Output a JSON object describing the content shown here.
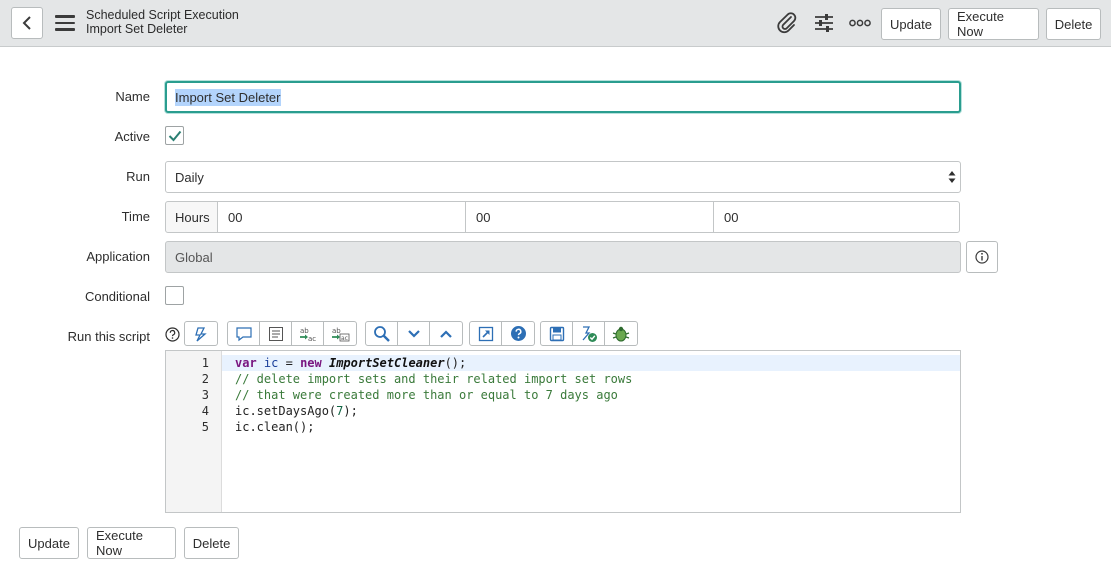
{
  "header": {
    "record_type": "Scheduled Script Execution",
    "record_name": "Import Set Deleter",
    "update_label": "Update",
    "execute_label": "Execute Now",
    "delete_label": "Delete"
  },
  "form": {
    "name_label": "Name",
    "name_value": "Import Set Deleter",
    "active_label": "Active",
    "active_checked": true,
    "run_label": "Run",
    "run_value": "Daily",
    "time_label": "Time",
    "time_unit": "Hours",
    "time_hours": "00",
    "time_minutes": "00",
    "time_seconds": "00",
    "application_label": "Application",
    "application_value": "Global",
    "conditional_label": "Conditional",
    "conditional_checked": false,
    "script_label": "Run this script"
  },
  "script": {
    "line_numbers": [
      "1",
      "2",
      "3",
      "4",
      "5"
    ],
    "line1": {
      "kw1": "var",
      "v": "ic",
      "eq": " = ",
      "kw2": "new",
      "cls": "ImportSetCleaner",
      "end": "();"
    },
    "line2": "// delete import sets and their related import set rows",
    "line3": "// that were created more than or equal to 7 days ago",
    "line4": {
      "pre": "ic.setDaysAgo(",
      "num": "7",
      "post": ");"
    },
    "line5": "ic.clean();"
  },
  "footer": {
    "update_label": "Update",
    "execute_label": "Execute Now",
    "delete_label": "Delete"
  },
  "icons": {
    "header": [
      "back-icon",
      "menu-icon",
      "paperclip-icon",
      "settings-sliders-icon",
      "more-icon"
    ],
    "toolbar": [
      "help-icon",
      "format-icon",
      "comment-icon",
      "format-code-icon",
      "replace-icon",
      "replace-all-icon",
      "search-icon",
      "next-icon",
      "previous-icon",
      "fullscreen-icon",
      "syntax-help-icon",
      "save-icon",
      "check-syntax-icon",
      "debug-icon"
    ],
    "info": "info-icon"
  },
  "colors": {
    "header_bg": "#e4e6e7",
    "focus_border": "#2a9d8f",
    "selection": "#b3d4fc",
    "check": "#2a7f72",
    "toolbar_blue": "#2d6fb5"
  }
}
